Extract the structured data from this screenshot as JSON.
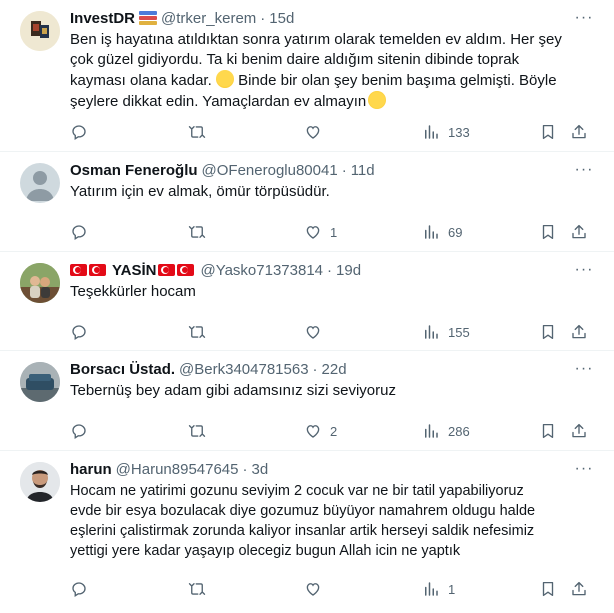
{
  "tweets": [
    {
      "name": "InvestDR",
      "handle": "@trker_kerem",
      "time": "15d",
      "text": "Ben iş hayatına atıldıktan sonra yatırım olarak temelden ev aldım. Her şey\nçok güzel gidiyordu. Ta ki benim daire aldığım sitenin dibinde toprak\nkayması olana kadar.",
      "text2": " Binde bir olan şey benim başıma gelmişti. Böyle\nşeylere dikkat edin. Yamaçlardan ev almayın",
      "likes": "",
      "views": "133",
      "avatar_desc": "book-cover-avatar"
    },
    {
      "name": "Osman Feneroğlu",
      "handle": "@OFeneroglu80041",
      "time": "11d",
      "text": "Yatırım için ev almak, ömür törpüsüdür.",
      "likes": "1",
      "views": "69"
    },
    {
      "name": "YASİN",
      "handle": "@Yasko71373814",
      "time": "19d",
      "text": "Teşekkürler hocam",
      "likes": "",
      "views": "155"
    },
    {
      "name": "Borsacı Üstad.",
      "handle": "@Berk3404781563",
      "time": "22d",
      "text": "Tebernüş bey adam gibi adamsınız sizi seviyoruz",
      "likes": "2",
      "views": "286"
    },
    {
      "name": "harun",
      "handle": "@Harun89547645",
      "time": "3d",
      "text": "Hocam ne yatirimi gozunu seviyim 2 cocuk var ne bir tatil yapabiliyoruz\nevde bir esya bozulacak diye gozumuz büyüyor namahrem oldugu halde\neşlerini çalistirmak zorunda kaliyor insanlar artik herseyi saldik nefesimiz\nyettigi yere kadar yaşayıp olecegiz bugun Allah icin ne yaptık",
      "likes": "",
      "views": "1"
    }
  ],
  "dot": "·",
  "more": "···",
  "colors": {
    "text": "#0f1419",
    "muted": "#536471",
    "border": "#eff3f4",
    "flag_red": "#e30a17"
  },
  "icons": [
    "reply-icon",
    "retweet-icon",
    "like-icon",
    "views-icon",
    "bookmark-icon",
    "share-icon",
    "more-icon"
  ]
}
